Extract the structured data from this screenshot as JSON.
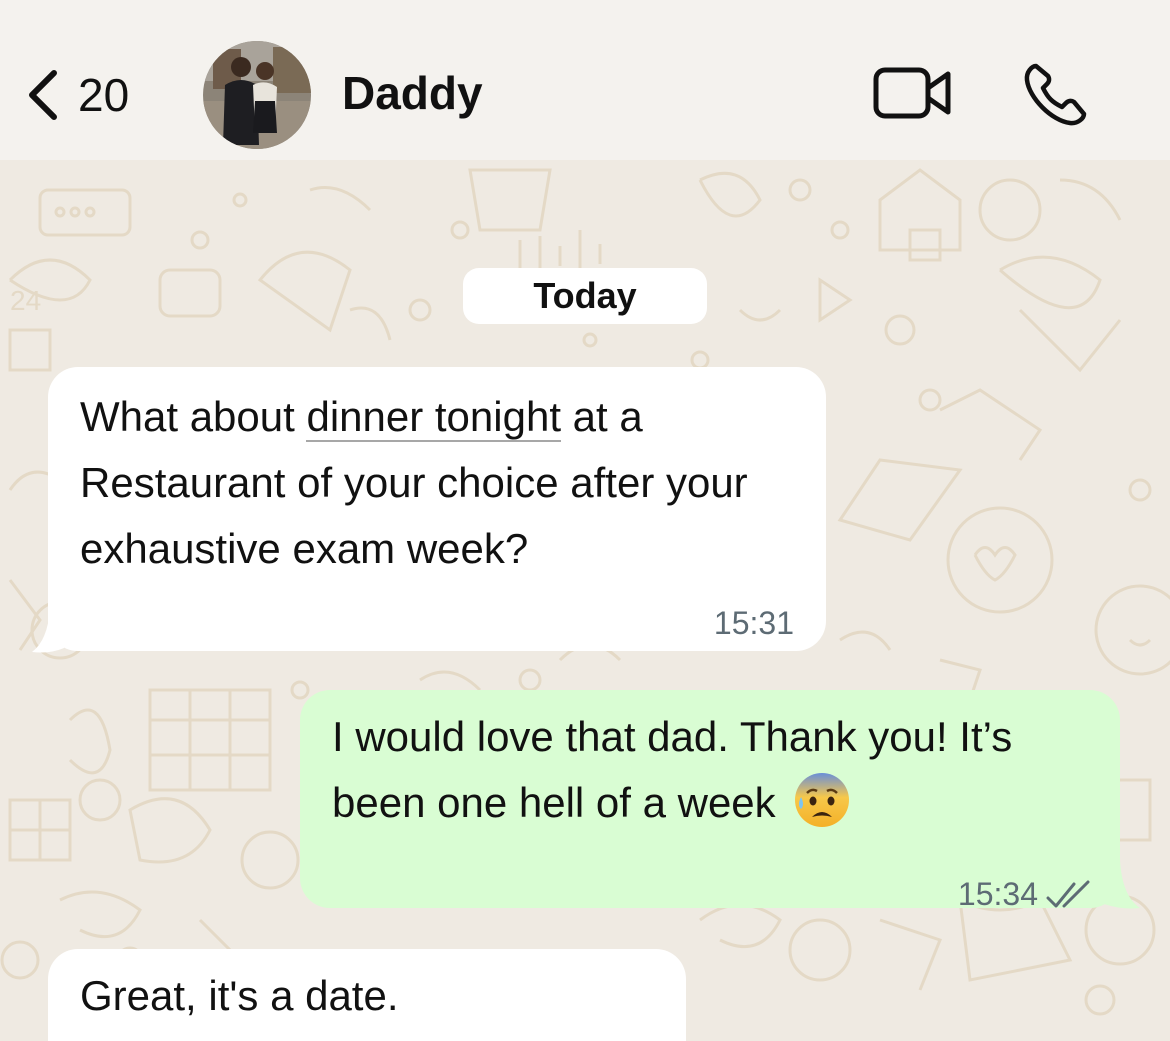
{
  "header": {
    "back_count": "20",
    "contact_name": "Daddy",
    "icons": [
      "chevron-left-icon",
      "video-call-icon",
      "phone-icon"
    ]
  },
  "chat": {
    "date_divider": "Today",
    "messages": [
      {
        "direction": "incoming",
        "text_parts": [
          "What about ",
          "dinner tonight",
          " at a Restaurant of your choice after your exhaustive exam week?"
        ],
        "time": "15:31"
      },
      {
        "direction": "outgoing",
        "text": "I would love that dad. Thank you! It’s been one hell of a week",
        "emoji": "anxious-face-with-sweat",
        "time": "15:34",
        "status": "read"
      },
      {
        "direction": "incoming",
        "text": "Great, it's a date."
      }
    ]
  },
  "colors": {
    "incoming_bubble": "#ffffff",
    "outgoing_bubble": "#d9fdd3",
    "chat_background": "#efeae2",
    "header_background": "#f4f2ee",
    "read_ticks": "#5d6b74"
  }
}
